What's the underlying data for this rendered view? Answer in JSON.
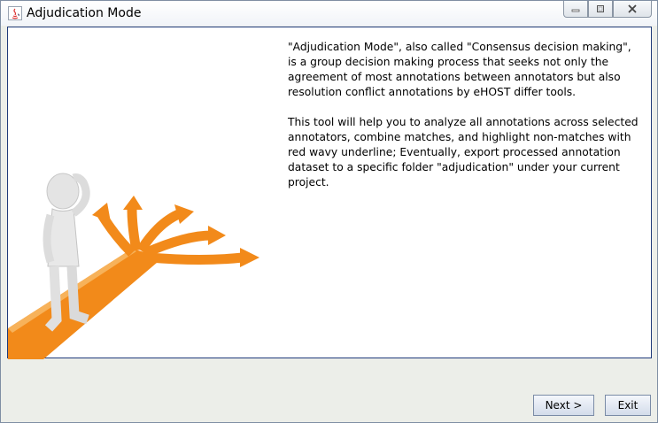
{
  "window": {
    "title": "Adjudication Mode",
    "controls": {
      "minimize_icon": "minimize-icon",
      "maximize_icon": "maximize-icon",
      "close_icon": "close-icon"
    }
  },
  "content": {
    "paragraph1": "\"Adjudication Mode\", also called \"Consensus decision making\", is a group decision making process that seeks not only the agreement of most annotations between annotators but also resolution conflict annotations by eHOST differ tools.",
    "paragraph2": "This tool will help you to analyze all annotations across selected annotators, combine matches, and highlight non-matches with red wavy underline; Eventually, export processed annotation dataset to a specific folder \"adjudication\" under your current project."
  },
  "buttons": {
    "next_label": "Next >",
    "exit_label": "Exit"
  },
  "colors": {
    "arrow_orange": "#f28a1a",
    "content_border": "#1f3a7a",
    "panel_bg": "#eceee9"
  }
}
